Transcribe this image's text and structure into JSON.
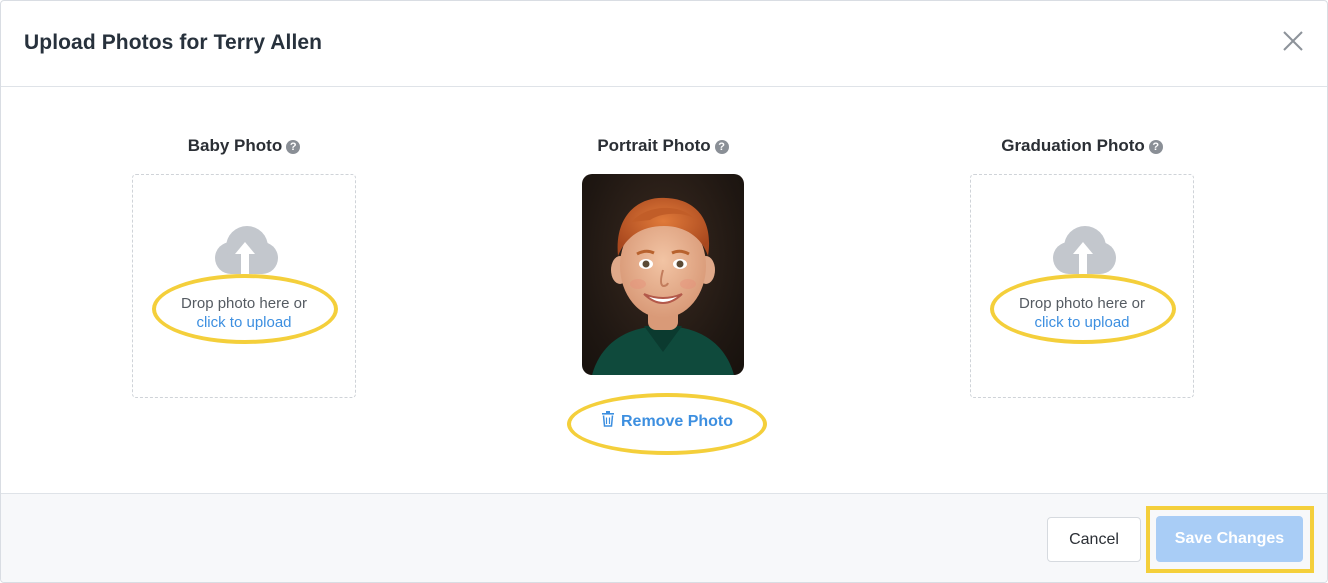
{
  "modal": {
    "title": "Upload Photos for Terry Allen",
    "close_icon": "close-icon"
  },
  "photos": [
    {
      "label": "Baby Photo",
      "help_icon": "question-circle-icon",
      "state": "empty",
      "drop_text": "Drop photo here or",
      "upload_link": "click to upload",
      "icon": "cloud-upload-icon"
    },
    {
      "label": "Portrait Photo",
      "help_icon": "question-circle-icon",
      "state": "uploaded",
      "remove_label": "Remove Photo",
      "remove_icon": "trash-icon"
    },
    {
      "label": "Graduation Photo",
      "help_icon": "question-circle-icon",
      "state": "empty",
      "drop_text": "Drop photo here or",
      "upload_link": "click to upload",
      "icon": "cloud-upload-icon"
    }
  ],
  "footer": {
    "cancel_label": "Cancel",
    "save_label": "Save Changes",
    "save_enabled": false
  },
  "colors": {
    "accent": "#3d8fe0",
    "save_disabled_bg": "#a9cdf6",
    "highlight": "#f4cf3b",
    "icon_grey": "#c3c7cd"
  }
}
